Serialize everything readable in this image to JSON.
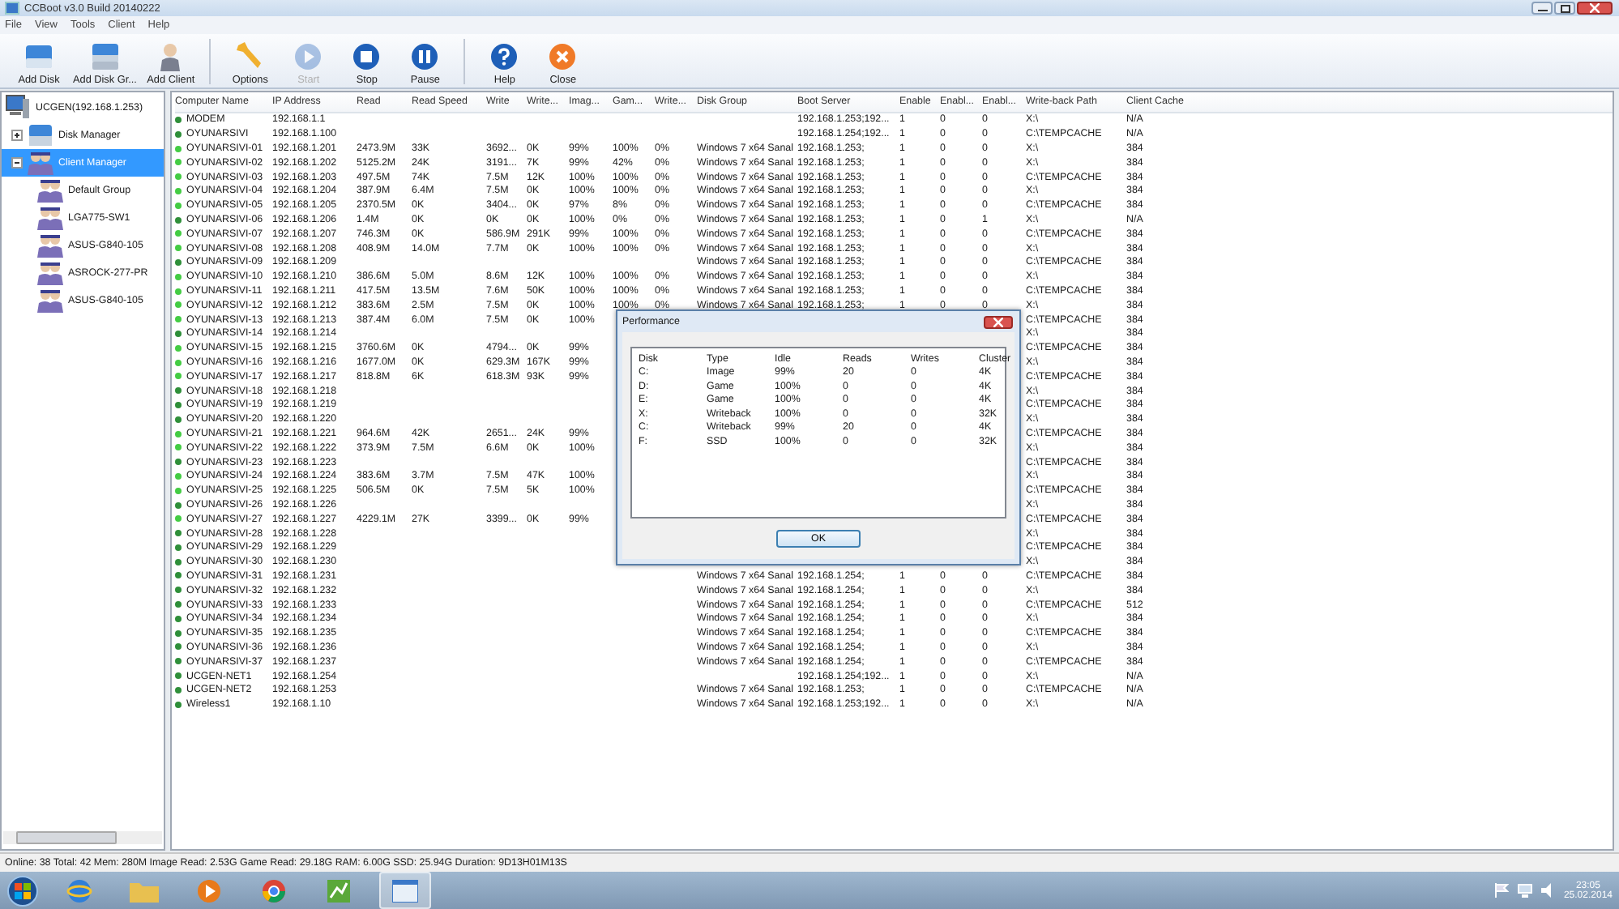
{
  "window": {
    "title": "CCBoot v3.0 Build 20140222"
  },
  "menu": [
    "File",
    "View",
    "Tools",
    "Client",
    "Help"
  ],
  "toolbar": [
    {
      "label": "Add Disk",
      "disabled": false
    },
    {
      "label": "Add Disk Gr...",
      "disabled": false
    },
    {
      "label": "Add Client",
      "disabled": false
    },
    {
      "label": "Options",
      "disabled": false
    },
    {
      "label": "Start",
      "disabled": true
    },
    {
      "label": "Stop",
      "disabled": false
    },
    {
      "label": "Pause",
      "disabled": false
    },
    {
      "label": "Help",
      "disabled": false
    },
    {
      "label": "Close",
      "disabled": false
    }
  ],
  "tree": {
    "label": "UCGEN(192.168.1.253)",
    "children": [
      {
        "label": "Disk Manager",
        "expanded": false,
        "selected": false
      },
      {
        "label": "Client Manager",
        "expanded": true,
        "selected": true,
        "children": [
          {
            "label": "Default Group"
          },
          {
            "label": "LGA775-SW1"
          },
          {
            "label": "ASUS-G840-105"
          },
          {
            "label": "ASROCK-277-PR"
          },
          {
            "label": "ASUS-G840-105"
          }
        ]
      }
    ]
  },
  "table": {
    "columns": [
      "Computer Name",
      "IP Address",
      "Read",
      "Read Speed",
      "Write",
      "Write...",
      "Imag...",
      "Gam...",
      "Write...",
      "Disk Group",
      "Boot Server",
      "Enable",
      "Enabl...",
      "Enabl...",
      "Write-back Path",
      "Client Cache"
    ],
    "rows": [
      {
        "color": "#2f8f3a",
        "cells": [
          "MODEM",
          "192.168.1.1",
          "",
          "",
          "",
          "",
          "",
          "",
          "",
          "",
          "192.168.1.253;192...",
          "1",
          "0",
          "0",
          "X:\\",
          "N/A"
        ]
      },
      {
        "color": "#2f8f3a",
        "cells": [
          "OYUNARSIVI",
          "192.168.1.100",
          "",
          "",
          "",
          "",
          "",
          "",
          "",
          "",
          "192.168.1.254;192...",
          "1",
          "0",
          "0",
          "C:\\TEMPCACHE",
          "N/A"
        ]
      },
      {
        "color": "#44cc44",
        "cells": [
          "OYUNARSIVI-01",
          "192.168.1.201",
          "2473.9M",
          "33K",
          "3692...",
          "0K",
          "99%",
          "100%",
          "0%",
          "Windows 7 x64 Sanal",
          "192.168.1.253;",
          "1",
          "0",
          "0",
          "X:\\",
          "384"
        ]
      },
      {
        "color": "#44cc44",
        "cells": [
          "OYUNARSIVI-02",
          "192.168.1.202",
          "5125.2M",
          "24K",
          "3191...",
          "7K",
          "99%",
          "42%",
          "0%",
          "Windows 7 x64 Sanal",
          "192.168.1.253;",
          "1",
          "0",
          "0",
          "X:\\",
          "384"
        ]
      },
      {
        "color": "#44cc44",
        "cells": [
          "OYUNARSIVI-03",
          "192.168.1.203",
          "497.5M",
          "74K",
          "7.5M",
          "12K",
          "100%",
          "100%",
          "0%",
          "Windows 7 x64 Sanal",
          "192.168.1.253;",
          "1",
          "0",
          "0",
          "C:\\TEMPCACHE",
          "384"
        ]
      },
      {
        "color": "#44cc44",
        "cells": [
          "OYUNARSIVI-04",
          "192.168.1.204",
          "387.9M",
          "6.4M",
          "7.5M",
          "0K",
          "100%",
          "100%",
          "0%",
          "Windows 7 x64 Sanal",
          "192.168.1.253;",
          "1",
          "0",
          "0",
          "X:\\",
          "384"
        ]
      },
      {
        "color": "#44cc44",
        "cells": [
          "OYUNARSIVI-05",
          "192.168.1.205",
          "2370.5M",
          "0K",
          "3404...",
          "0K",
          "97%",
          "8%",
          "0%",
          "Windows 7 x64 Sanal",
          "192.168.1.253;",
          "1",
          "0",
          "0",
          "C:\\TEMPCACHE",
          "384"
        ]
      },
      {
        "color": "#2f8f3a",
        "cells": [
          "OYUNARSIVI-06",
          "192.168.1.206",
          "1.4M",
          "0K",
          "0K",
          "0K",
          "100%",
          "0%",
          "0%",
          "Windows 7 x64 Sanal",
          "192.168.1.253;",
          "1",
          "0",
          "1",
          "X:\\",
          "N/A"
        ]
      },
      {
        "color": "#44cc44",
        "cells": [
          "OYUNARSIVI-07",
          "192.168.1.207",
          "746.3M",
          "0K",
          "586.9M",
          "291K",
          "99%",
          "100%",
          "0%",
          "Windows 7 x64 Sanal",
          "192.168.1.253;",
          "1",
          "0",
          "0",
          "C:\\TEMPCACHE",
          "384"
        ]
      },
      {
        "color": "#44cc44",
        "cells": [
          "OYUNARSIVI-08",
          "192.168.1.208",
          "408.9M",
          "14.0M",
          "7.7M",
          "0K",
          "100%",
          "100%",
          "0%",
          "Windows 7 x64 Sanal",
          "192.168.1.253;",
          "1",
          "0",
          "0",
          "X:\\",
          "384"
        ]
      },
      {
        "color": "#2f8f3a",
        "cells": [
          "OYUNARSIVI-09",
          "192.168.1.209",
          "",
          "",
          "",
          "",
          "",
          "",
          "",
          "Windows 7 x64 Sanal",
          "192.168.1.253;",
          "1",
          "0",
          "0",
          "C:\\TEMPCACHE",
          "384"
        ]
      },
      {
        "color": "#44cc44",
        "cells": [
          "OYUNARSIVI-10",
          "192.168.1.210",
          "386.6M",
          "5.0M",
          "8.6M",
          "12K",
          "100%",
          "100%",
          "0%",
          "Windows 7 x64 Sanal",
          "192.168.1.253;",
          "1",
          "0",
          "0",
          "X:\\",
          "384"
        ]
      },
      {
        "color": "#44cc44",
        "cells": [
          "OYUNARSIVI-11",
          "192.168.1.211",
          "417.5M",
          "13.5M",
          "7.6M",
          "50K",
          "100%",
          "100%",
          "0%",
          "Windows 7 x64 Sanal",
          "192.168.1.253;",
          "1",
          "0",
          "0",
          "C:\\TEMPCACHE",
          "384"
        ]
      },
      {
        "color": "#44cc44",
        "cells": [
          "OYUNARSIVI-12",
          "192.168.1.212",
          "383.6M",
          "2.5M",
          "7.5M",
          "0K",
          "100%",
          "100%",
          "0%",
          "Windows 7 x64 Sanal",
          "192.168.1.253;",
          "1",
          "0",
          "0",
          "X:\\",
          "384"
        ]
      },
      {
        "color": "#44cc44",
        "cells": [
          "OYUNARSIVI-13",
          "192.168.1.213",
          "387.4M",
          "6.0M",
          "7.5M",
          "0K",
          "100%",
          "",
          "",
          "",
          "",
          "",
          "",
          "",
          "C:\\TEMPCACHE",
          "384"
        ]
      },
      {
        "color": "#2f8f3a",
        "cells": [
          "OYUNARSIVI-14",
          "192.168.1.214",
          "",
          "",
          "",
          "",
          "",
          "",
          "",
          "",
          "",
          "",
          "",
          "",
          "X:\\",
          "384"
        ]
      },
      {
        "color": "#44cc44",
        "cells": [
          "OYUNARSIVI-15",
          "192.168.1.215",
          "3760.6M",
          "0K",
          "4794...",
          "0K",
          "99%",
          "",
          "",
          "",
          "",
          "",
          "",
          "",
          "C:\\TEMPCACHE",
          "384"
        ]
      },
      {
        "color": "#44cc44",
        "cells": [
          "OYUNARSIVI-16",
          "192.168.1.216",
          "1677.0M",
          "0K",
          "629.3M",
          "167K",
          "99%",
          "",
          "",
          "",
          "",
          "",
          "",
          "",
          "X:\\",
          "384"
        ]
      },
      {
        "color": "#44cc44",
        "cells": [
          "OYUNARSIVI-17",
          "192.168.1.217",
          "818.8M",
          "6K",
          "618.3M",
          "93K",
          "99%",
          "",
          "",
          "",
          "",
          "",
          "",
          "",
          "C:\\TEMPCACHE",
          "384"
        ]
      },
      {
        "color": "#2f8f3a",
        "cells": [
          "OYUNARSIVI-18",
          "192.168.1.218",
          "",
          "",
          "",
          "",
          "",
          "",
          "",
          "",
          "",
          "",
          "",
          "",
          "X:\\",
          "384"
        ]
      },
      {
        "color": "#2f8f3a",
        "cells": [
          "OYUNARSIVI-19",
          "192.168.1.219",
          "",
          "",
          "",
          "",
          "",
          "",
          "",
          "",
          "",
          "",
          "",
          "",
          "C:\\TEMPCACHE",
          "384"
        ]
      },
      {
        "color": "#2f8f3a",
        "cells": [
          "OYUNARSIVI-20",
          "192.168.1.220",
          "",
          "",
          "",
          "",
          "",
          "",
          "",
          "",
          "",
          "",
          "",
          "",
          "X:\\",
          "384"
        ]
      },
      {
        "color": "#44cc44",
        "cells": [
          "OYUNARSIVI-21",
          "192.168.1.221",
          "964.6M",
          "42K",
          "2651...",
          "24K",
          "99%",
          "",
          "",
          "",
          "",
          "",
          "",
          "",
          "C:\\TEMPCACHE",
          "384"
        ]
      },
      {
        "color": "#44cc44",
        "cells": [
          "OYUNARSIVI-22",
          "192.168.1.222",
          "373.9M",
          "7.5M",
          "6.6M",
          "0K",
          "100%",
          "",
          "",
          "",
          "",
          "",
          "",
          "",
          "X:\\",
          "384"
        ]
      },
      {
        "color": "#2f8f3a",
        "cells": [
          "OYUNARSIVI-23",
          "192.168.1.223",
          "",
          "",
          "",
          "",
          "",
          "",
          "",
          "",
          "",
          "",
          "",
          "",
          "C:\\TEMPCACHE",
          "384"
        ]
      },
      {
        "color": "#44cc44",
        "cells": [
          "OYUNARSIVI-24",
          "192.168.1.224",
          "383.6M",
          "3.7M",
          "7.5M",
          "47K",
          "100%",
          "",
          "",
          "",
          "",
          "",
          "",
          "",
          "X:\\",
          "384"
        ]
      },
      {
        "color": "#44cc44",
        "cells": [
          "OYUNARSIVI-25",
          "192.168.1.225",
          "506.5M",
          "0K",
          "7.5M",
          "5K",
          "100%",
          "",
          "",
          "",
          "",
          "",
          "",
          "",
          "C:\\TEMPCACHE",
          "384"
        ]
      },
      {
        "color": "#2f8f3a",
        "cells": [
          "OYUNARSIVI-26",
          "192.168.1.226",
          "",
          "",
          "",
          "",
          "",
          "",
          "",
          "",
          "",
          "",
          "",
          "",
          "X:\\",
          "384"
        ]
      },
      {
        "color": "#44cc44",
        "cells": [
          "OYUNARSIVI-27",
          "192.168.1.227",
          "4229.1M",
          "27K",
          "3399...",
          "0K",
          "99%",
          "",
          "",
          "",
          "",
          "",
          "",
          "",
          "C:\\TEMPCACHE",
          "384"
        ]
      },
      {
        "color": "#2f8f3a",
        "cells": [
          "OYUNARSIVI-28",
          "192.168.1.228",
          "",
          "",
          "",
          "",
          "",
          "",
          "",
          "",
          "",
          "",
          "",
          "",
          "X:\\",
          "384"
        ]
      },
      {
        "color": "#2f8f3a",
        "cells": [
          "OYUNARSIVI-29",
          "192.168.1.229",
          "",
          "",
          "",
          "",
          "",
          "",
          "",
          "",
          "",
          "",
          "",
          "",
          "C:\\TEMPCACHE",
          "384"
        ]
      },
      {
        "color": "#2f8f3a",
        "cells": [
          "OYUNARSIVI-30",
          "192.168.1.230",
          "",
          "",
          "",
          "",
          "",
          "",
          "",
          "",
          "",
          "",
          "",
          "",
          "X:\\",
          "384"
        ]
      },
      {
        "color": "#2f8f3a",
        "cells": [
          "OYUNARSIVI-31",
          "192.168.1.231",
          "",
          "",
          "",
          "",
          "",
          "",
          "",
          "Windows 7 x64 Sanal",
          "192.168.1.254;",
          "1",
          "0",
          "0",
          "C:\\TEMPCACHE",
          "384"
        ]
      },
      {
        "color": "#2f8f3a",
        "cells": [
          "OYUNARSIVI-32",
          "192.168.1.232",
          "",
          "",
          "",
          "",
          "",
          "",
          "",
          "Windows 7 x64 Sanal",
          "192.168.1.254;",
          "1",
          "0",
          "0",
          "X:\\",
          "384"
        ]
      },
      {
        "color": "#2f8f3a",
        "cells": [
          "OYUNARSIVI-33",
          "192.168.1.233",
          "",
          "",
          "",
          "",
          "",
          "",
          "",
          "Windows 7 x64 Sanal",
          "192.168.1.254;",
          "1",
          "0",
          "0",
          "C:\\TEMPCACHE",
          "512"
        ]
      },
      {
        "color": "#2f8f3a",
        "cells": [
          "OYUNARSIVI-34",
          "192.168.1.234",
          "",
          "",
          "",
          "",
          "",
          "",
          "",
          "Windows 7 x64 Sanal",
          "192.168.1.254;",
          "1",
          "0",
          "0",
          "X:\\",
          "384"
        ]
      },
      {
        "color": "#2f8f3a",
        "cells": [
          "OYUNARSIVI-35",
          "192.168.1.235",
          "",
          "",
          "",
          "",
          "",
          "",
          "",
          "Windows 7 x64 Sanal",
          "192.168.1.254;",
          "1",
          "0",
          "0",
          "C:\\TEMPCACHE",
          "384"
        ]
      },
      {
        "color": "#2f8f3a",
        "cells": [
          "OYUNARSIVI-36",
          "192.168.1.236",
          "",
          "",
          "",
          "",
          "",
          "",
          "",
          "Windows 7 x64 Sanal",
          "192.168.1.254;",
          "1",
          "0",
          "0",
          "X:\\",
          "384"
        ]
      },
      {
        "color": "#2f8f3a",
        "cells": [
          "OYUNARSIVI-37",
          "192.168.1.237",
          "",
          "",
          "",
          "",
          "",
          "",
          "",
          "Windows 7 x64 Sanal",
          "192.168.1.254;",
          "1",
          "0",
          "0",
          "C:\\TEMPCACHE",
          "384"
        ]
      },
      {
        "color": "#2f8f3a",
        "cells": [
          "UCGEN-NET1",
          "192.168.1.254",
          "",
          "",
          "",
          "",
          "",
          "",
          "",
          "",
          "192.168.1.254;192...",
          "1",
          "0",
          "0",
          "X:\\",
          "N/A"
        ]
      },
      {
        "color": "#2f8f3a",
        "cells": [
          "UCGEN-NET2",
          "192.168.1.253",
          "",
          "",
          "",
          "",
          "",
          "",
          "",
          "Windows 7 x64 Sanal",
          "192.168.1.253;",
          "1",
          "0",
          "0",
          "C:\\TEMPCACHE",
          "N/A"
        ]
      },
      {
        "color": "#2f8f3a",
        "cells": [
          "Wireless1",
          "192.168.1.10",
          "",
          "",
          "",
          "",
          "",
          "",
          "",
          "Windows 7 x64 Sanal",
          "192.168.1.253;192...",
          "1",
          "0",
          "0",
          "X:\\",
          "N/A"
        ]
      }
    ]
  },
  "dialog": {
    "title": "Performance",
    "columns": [
      "Disk",
      "Type",
      "Idle",
      "Reads",
      "Writes",
      "Cluster"
    ],
    "rows": [
      [
        "C:",
        "Image",
        "99%",
        "20",
        "0",
        "4K"
      ],
      [
        "D:",
        "Game",
        "100%",
        "0",
        "0",
        "4K"
      ],
      [
        "E:",
        "Game",
        "100%",
        "0",
        "0",
        "4K"
      ],
      [
        "X:",
        "Writeback",
        "100%",
        "0",
        "0",
        "32K"
      ],
      [
        "C:",
        "Writeback",
        "99%",
        "20",
        "0",
        "4K"
      ],
      [
        "F:",
        "SSD",
        "100%",
        "0",
        "0",
        "32K"
      ]
    ],
    "ok": "OK"
  },
  "status_bar": "Online: 38 Total: 42 Mem: 280M Image Read: 2.53G Game Read: 29.18G RAM: 6.00G SSD: 25.94G Duration: 9D13H01M13S",
  "taskbar": {
    "time": "23:05",
    "date": "25.02.2014"
  }
}
